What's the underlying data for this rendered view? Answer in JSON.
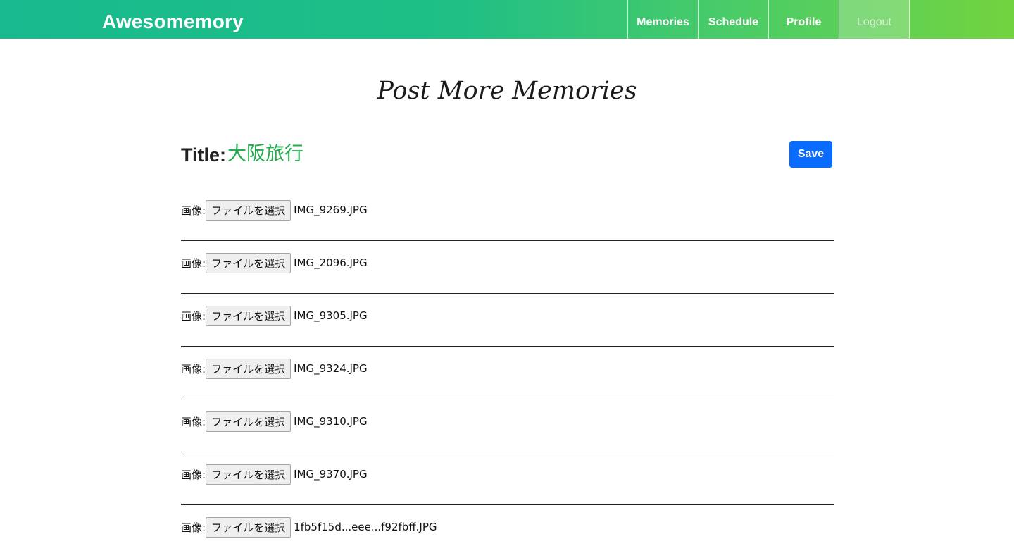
{
  "nav": {
    "brand": "Awesomemory",
    "items": [
      {
        "label": "Memories"
      },
      {
        "label": "Schedule"
      },
      {
        "label": "Profile"
      },
      {
        "label": "Logout"
      }
    ]
  },
  "heading": "Post More Memories",
  "title": {
    "label": "Title:",
    "value": "大阪旅行"
  },
  "save_label": "Save",
  "colors": {
    "navbar_start": "#17ba8e",
    "navbar_end": "#72d33f",
    "title_value": "#21ae4c",
    "save_button": "#0a6cff"
  },
  "rows": [
    {
      "label": "画像:",
      "button": "ファイルを選択",
      "file": "IMG_9269.JPG"
    },
    {
      "label": "画像:",
      "button": "ファイルを選択",
      "file": "IMG_2096.JPG"
    },
    {
      "label": "画像:",
      "button": "ファイルを選択",
      "file": "IMG_9305.JPG"
    },
    {
      "label": "画像:",
      "button": "ファイルを選択",
      "file": "IMG_9324.JPG"
    },
    {
      "label": "画像:",
      "button": "ファイルを選択",
      "file": "IMG_9310.JPG"
    },
    {
      "label": "画像:",
      "button": "ファイルを選択",
      "file": "IMG_9370.JPG"
    },
    {
      "label": "画像:",
      "button": "ファイルを選択",
      "file": "1fb5f15d...eee...f92fbff.JPG"
    }
  ]
}
